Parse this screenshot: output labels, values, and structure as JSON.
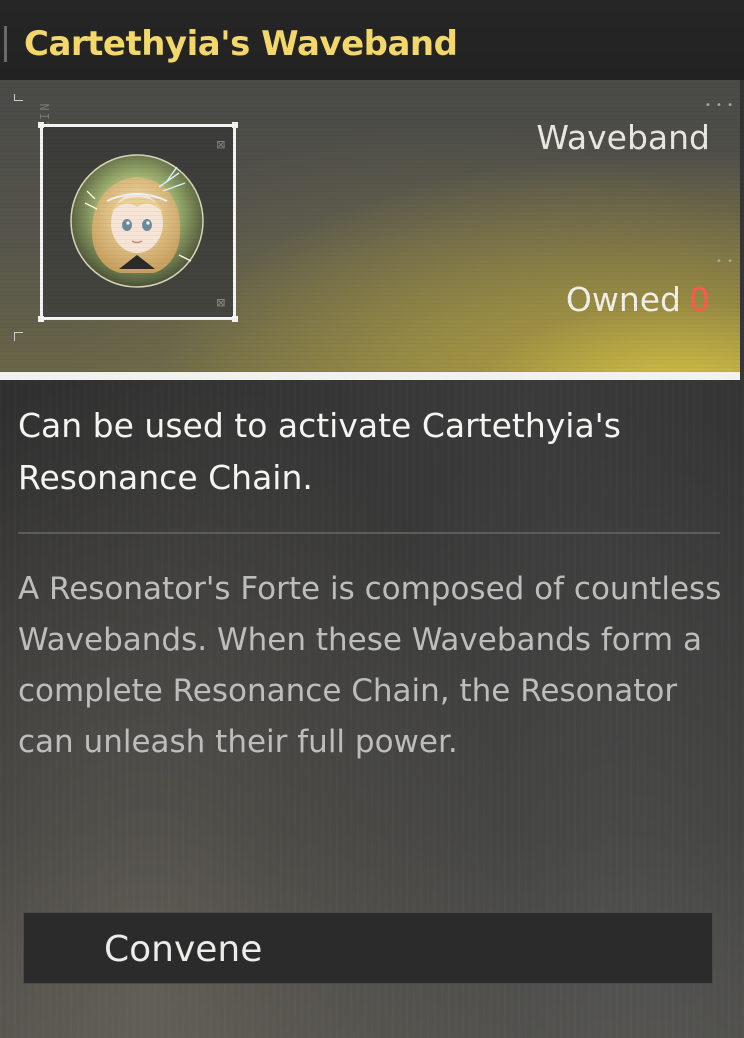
{
  "title": "Cartethyia's Waveband",
  "item": {
    "type": "Waveband",
    "owned_label": "Owned",
    "owned_count": "0",
    "icon": "cartethyia-portrait-icon",
    "side_code": "ΣΤΚΓΚΙΝ"
  },
  "description": "Can be used to activate Cartethyia's Resonance Chain.",
  "lore": "A Resonator's Forte is composed of countless Wavebands. When these Wavebands form a complete Resonance Chain, the Resonator can unleash their full power.",
  "actions": {
    "convene_label": "Convene"
  },
  "colors": {
    "title": "#f3d76a",
    "owned_count": "#ff5a4f",
    "header_glow": "#e1cd46"
  }
}
